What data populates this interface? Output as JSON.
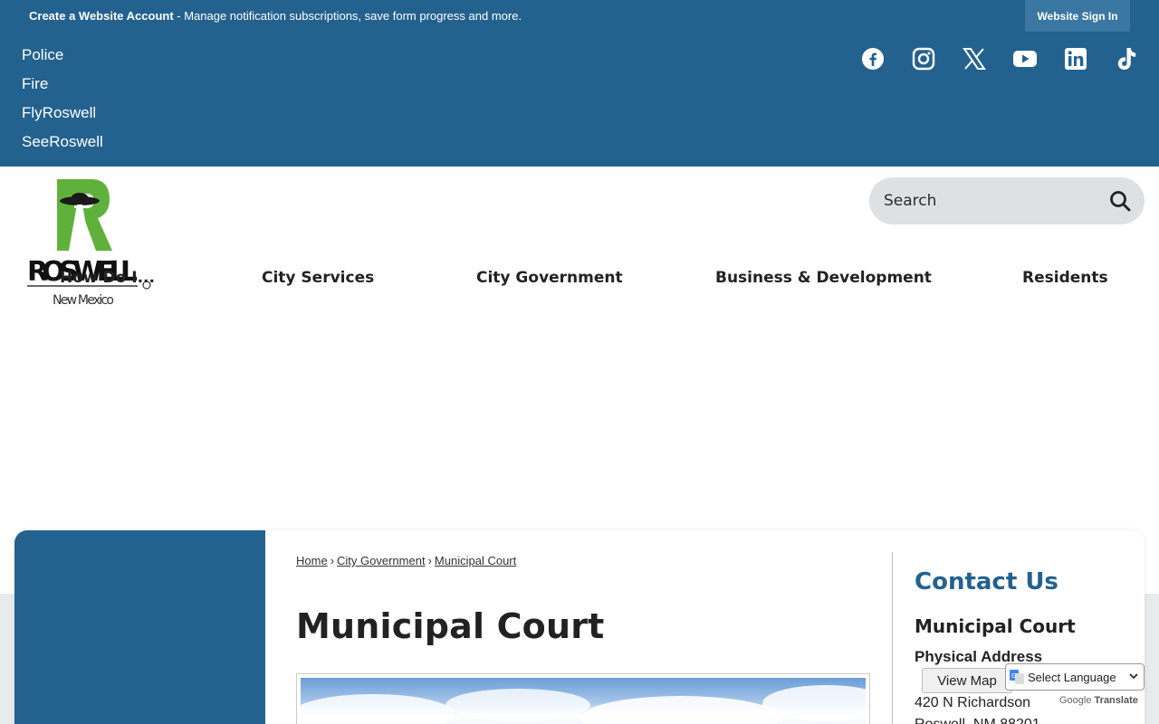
{
  "topbar": {
    "create_account": "Create a Website Account",
    "message": " - Manage notification subscriptions, save form progress and more.",
    "sign_in": "Website Sign In"
  },
  "quick_links": [
    "Police",
    "Fire",
    "FlyRoswell",
    "SeeRoswell"
  ],
  "social": [
    "facebook-icon",
    "instagram-icon",
    "x-icon",
    "youtube-icon",
    "linkedin-icon",
    "tiktok-icon"
  ],
  "logo": {
    "name": "ROSWELL",
    "sub": "New Mexico"
  },
  "search": {
    "placeholder": "Search"
  },
  "nav": {
    "how_do_i": "How Do I...",
    "items": [
      "City Services",
      "City Government",
      "Business & Development",
      "Residents"
    ]
  },
  "breadcrumb": [
    "Home",
    "City Government",
    "Municipal Court"
  ],
  "page": {
    "title": "Municipal Court"
  },
  "contact": {
    "heading": "Contact Us",
    "org": "Municipal Court",
    "label": "Physical Address",
    "view_map": "View Map",
    "address1": "420 N Richardson",
    "address2": "Roswell, NM 88201"
  },
  "translate": {
    "select": "Select Language",
    "powered_google": "Google",
    "powered_translate": "Translate"
  },
  "colors": {
    "primary": "#23618f",
    "logo_green": "#5fb13c"
  }
}
